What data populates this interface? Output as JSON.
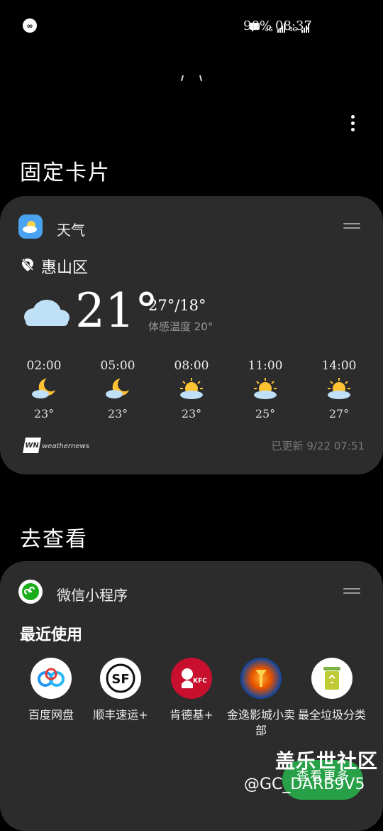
{
  "status_bar": {
    "battery": "90%",
    "time": "08:37",
    "net_label_1": "4G",
    "net_label_2": "4G"
  },
  "section_pinned": "固定卡片",
  "weather_card": {
    "app_name": "天气",
    "location": "惠山区",
    "temp": "21°",
    "high_low": "27°/18°",
    "feels_like": "体感温度 20°",
    "hourly": [
      {
        "time": "02:00",
        "temp": "23°",
        "icon": "moon-cloud-icon"
      },
      {
        "time": "05:00",
        "temp": "23°",
        "icon": "moon-cloud-icon"
      },
      {
        "time": "08:00",
        "temp": "23°",
        "icon": "sun-cloud-icon"
      },
      {
        "time": "11:00",
        "temp": "25°",
        "icon": "sun-cloud-icon"
      },
      {
        "time": "14:00",
        "temp": "27°",
        "icon": "sun-cloud-icon"
      }
    ],
    "provider": "weathernews",
    "provider_badge": "WN",
    "updated": "已更新 9/22 07:51"
  },
  "section_explore": "去查看",
  "mini_card": {
    "app_name": "微信小程序",
    "recent_title": "最近使用",
    "apps": [
      {
        "label": "百度网盘"
      },
      {
        "label": "顺丰速运+"
      },
      {
        "label": "肯德基+"
      },
      {
        "label": "金逸影城小卖部"
      },
      {
        "label": "最全垃圾分类"
      }
    ],
    "kfc_text": "KFC",
    "see_more": "查看更多"
  },
  "watermark": {
    "line1": "盖乐世社区",
    "line2": "@GC_DARB9V5"
  },
  "colors": {
    "background": "#000000",
    "card": "#2c2c2c",
    "accent_green": "#27a048",
    "weather_icon_blue": "#4aa3f0"
  }
}
